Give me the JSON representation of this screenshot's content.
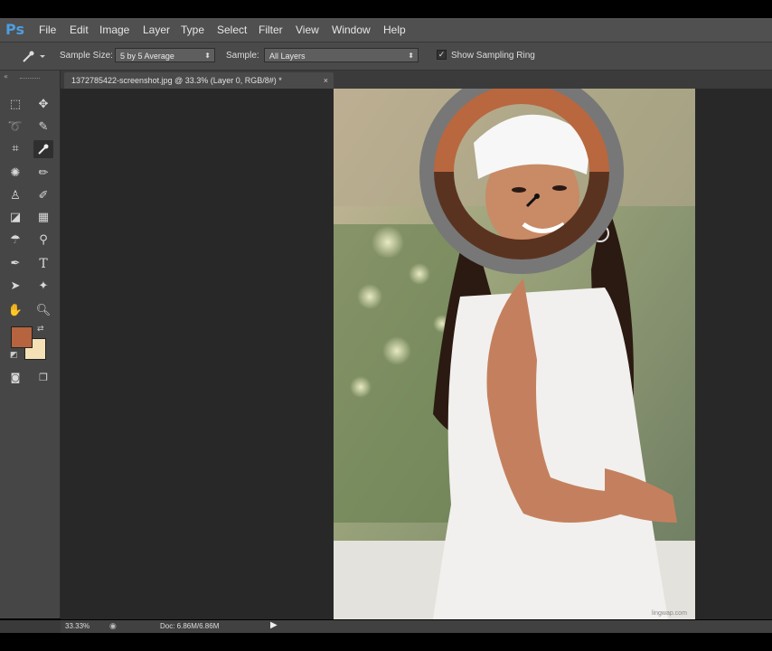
{
  "app": {
    "logo": "Ps"
  },
  "menu": [
    "File",
    "Edit",
    "Image",
    "Layer",
    "Type",
    "Select",
    "Filter",
    "View",
    "Window",
    "Help"
  ],
  "options": {
    "sample_size_label": "Sample Size:",
    "sample_size_value": "5 by 5 Average",
    "sample_label": "Sample:",
    "sample_value": "All Layers",
    "show_ring_label": "Show Sampling Ring",
    "show_ring_checked": true
  },
  "document": {
    "tab_title": "1372785422-screenshot.jpg @ 33.3% (Layer 0, RGB/8#) *",
    "close_glyph": "×"
  },
  "colors": {
    "foreground": "#b5643f",
    "background": "#f5e1b5",
    "ring_top": "#b9673f",
    "ring_bottom": "#5a3320",
    "ring_outer": "#777777"
  },
  "status": {
    "zoom": "33.33%",
    "doc": "Doc: 6.86M/6.86M"
  },
  "watermark": "lingwap.com"
}
